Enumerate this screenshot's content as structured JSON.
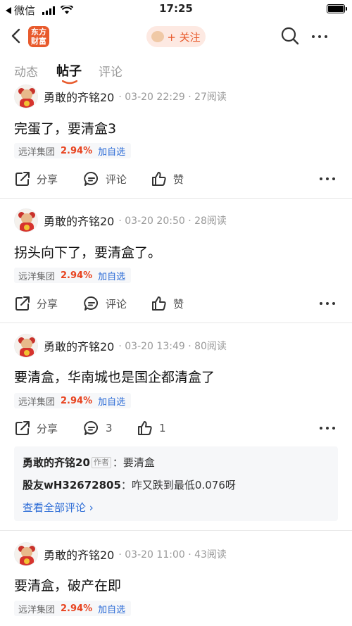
{
  "status_bar": {
    "carrier": "微信",
    "time": "17:25"
  },
  "nav": {
    "logo_text_1": "东方",
    "logo_text_2": "财富",
    "follow_label": "+ 关注"
  },
  "tabs": [
    {
      "label": "动态"
    },
    {
      "label": "帖子"
    },
    {
      "label": "评论"
    }
  ],
  "posts": [
    {
      "author": "勇敢的齐铭20",
      "meta": "· 03-20 22:29 · 27阅读",
      "content": "完蛋了，要清盒3",
      "stock": {
        "name": "远洋集团",
        "pct": "2.94%",
        "add": "加自选"
      },
      "share": "分享",
      "comment": "评论",
      "like": "赞"
    },
    {
      "author": "勇敢的齐铭20",
      "meta": "· 03-20 20:50 · 28阅读",
      "content": "拐头向下了，要清盒了。",
      "stock": {
        "name": "远洋集团",
        "pct": "2.94%",
        "add": "加自选"
      },
      "share": "分享",
      "comment": "评论",
      "like": "赞"
    },
    {
      "author": "勇敢的齐铭20",
      "meta": "· 03-20 13:49 · 80阅读",
      "content": "要清盒，华南城也是国企都清盒了",
      "stock": {
        "name": "远洋集团",
        "pct": "2.94%",
        "add": "加自选"
      },
      "share": "分享",
      "comment": "3",
      "like": "1",
      "comments": [
        {
          "user": "勇敢的齐铭20",
          "tag": "作者",
          "text": "：要清盒"
        },
        {
          "user": "股友wH32672805",
          "text": "：咋又跌到最低0.076呀"
        }
      ],
      "see_all": "查看全部评论 ›"
    },
    {
      "author": "勇敢的齐铭20",
      "meta": "· 03-20 11:00 · 43阅读",
      "content": "要清盒，破产在即",
      "stock": {
        "name": "远洋集团",
        "pct": "2.94%",
        "add": "加自选"
      }
    }
  ],
  "colors": {
    "accent": "#e85a2c",
    "rise": "#e8431f",
    "link": "#2b6bd6"
  }
}
